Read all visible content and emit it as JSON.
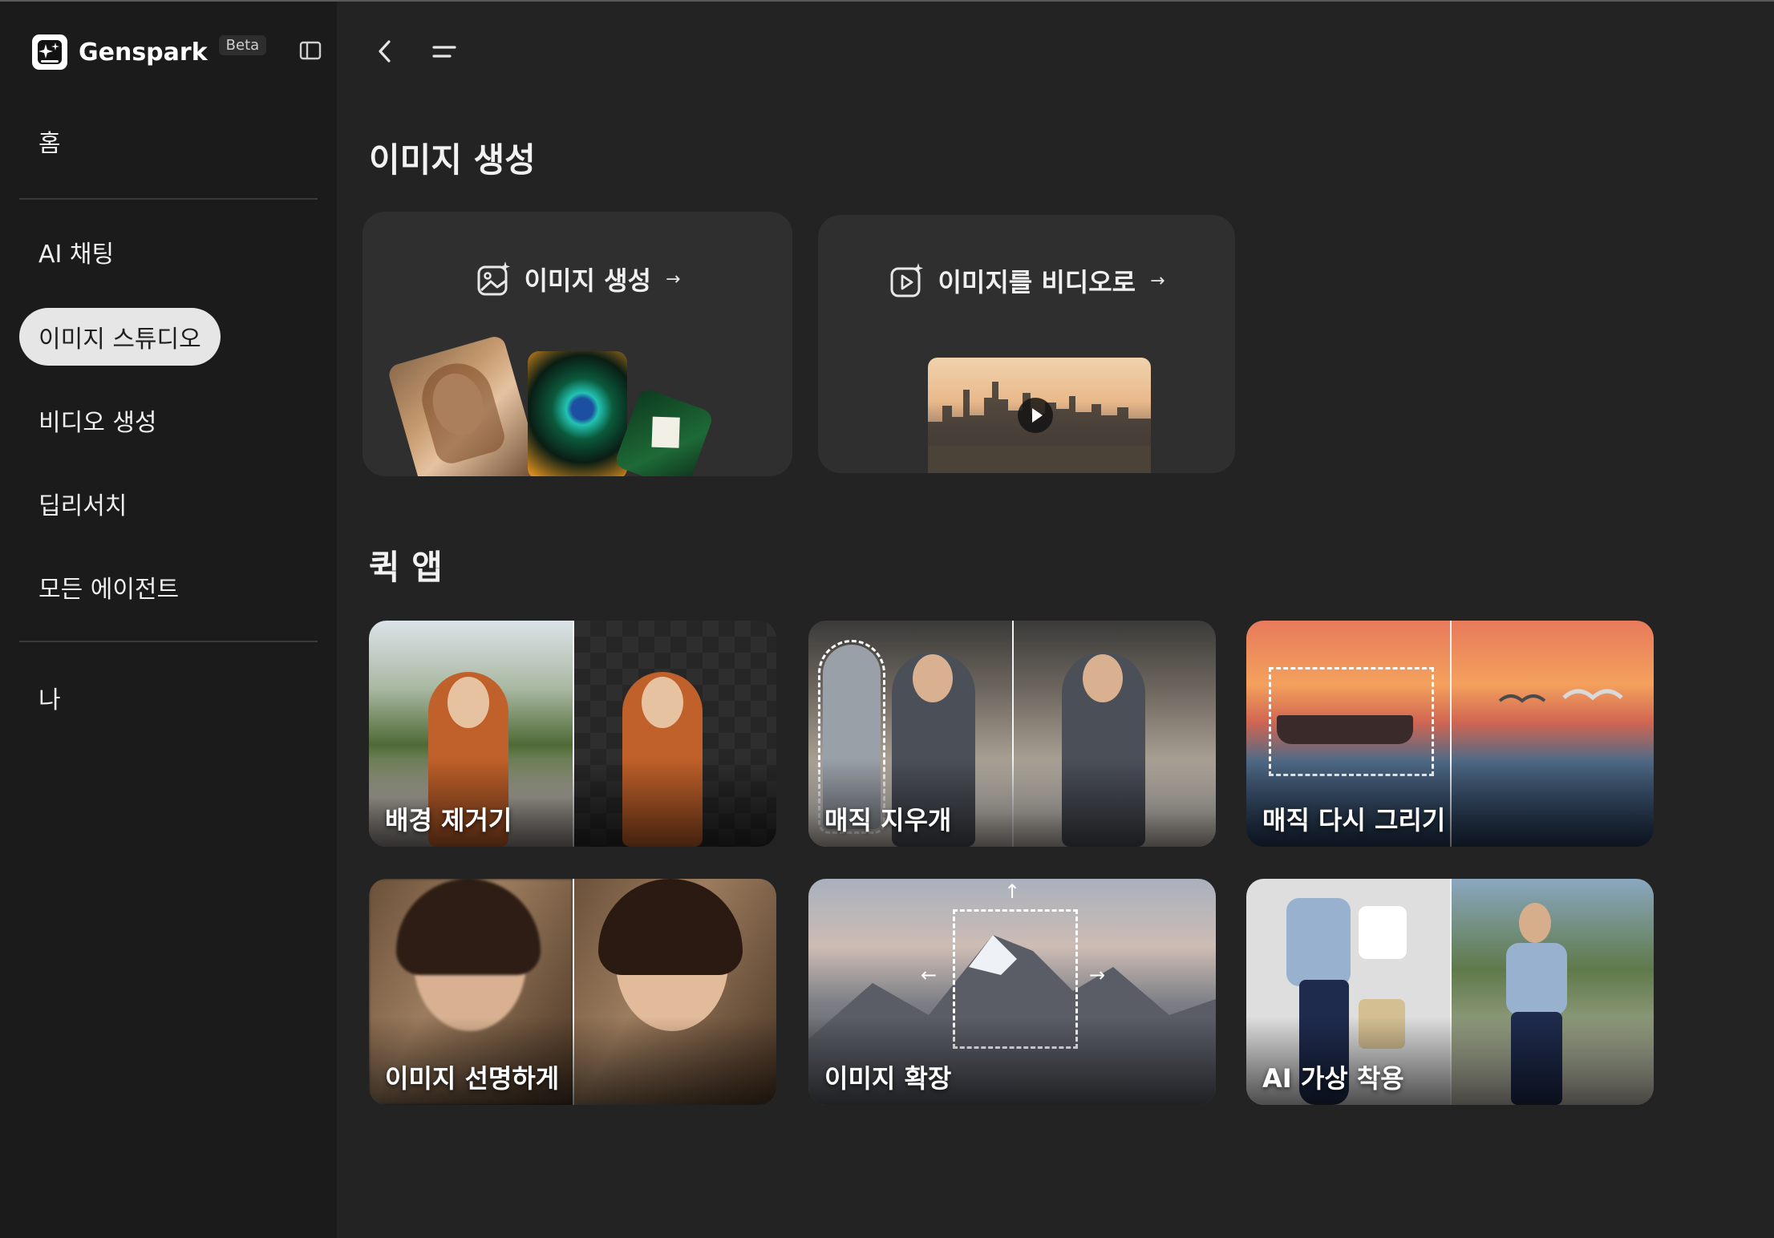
{
  "brand": {
    "name": "Genspark",
    "badge": "Beta"
  },
  "sidebar": {
    "items": [
      {
        "label": "홈"
      },
      {
        "label": "AI 채팅"
      },
      {
        "label": "이미지 스튜디오",
        "active": true
      },
      {
        "label": "비디오 생성"
      },
      {
        "label": "딥리서치"
      },
      {
        "label": "모든 에이전트"
      },
      {
        "label": "나"
      }
    ]
  },
  "main": {
    "section_title": "이미지 생성",
    "generators": [
      {
        "label": "이미지 생성",
        "icon": "image-sparkle-icon"
      },
      {
        "label": "이미지를 비디오로",
        "icon": "video-sparkle-icon"
      }
    ],
    "quick_apps_title": "퀵 앱",
    "quick_apps": [
      {
        "label": "배경 제거기"
      },
      {
        "label": "매직 지우개"
      },
      {
        "label": "매직 다시 그리기"
      },
      {
        "label": "이미지 선명하게"
      },
      {
        "label": "이미지 확장"
      },
      {
        "label": "AI 가상 착용"
      }
    ]
  },
  "colors": {
    "sidebar_bg": "#1b1b1b",
    "main_bg": "#232323",
    "card_bg": "#2f2f2f",
    "active_pill": "#e6e6e6"
  }
}
